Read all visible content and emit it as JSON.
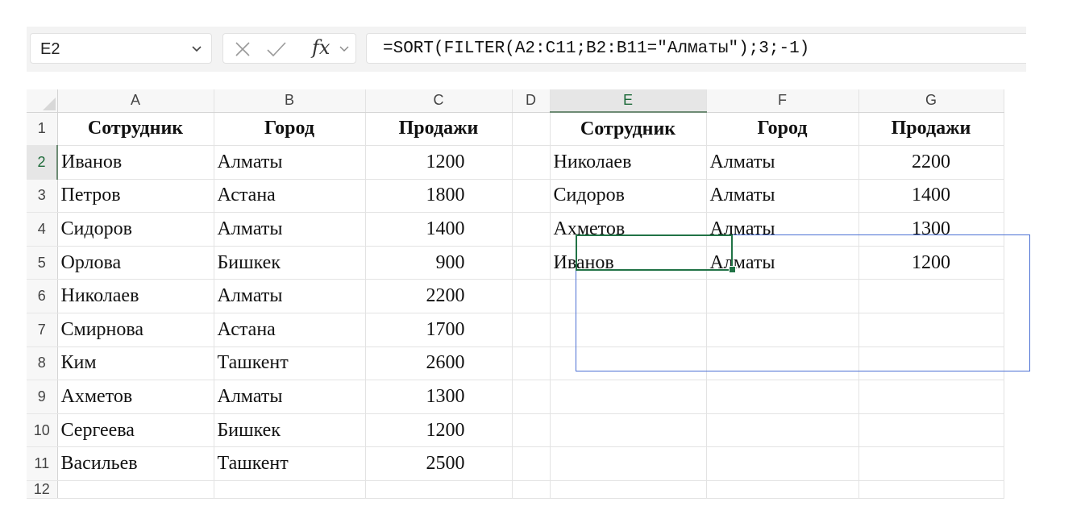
{
  "formula_bar": {
    "name_box": "E2",
    "formula": "=SORT(FILTER(A2:C11;B2:B11=\"Алматы\");3;-1)",
    "fx_label": "fx"
  },
  "columns": [
    "A",
    "B",
    "C",
    "D",
    "E",
    "F",
    "G"
  ],
  "selected_cell": "E2",
  "rows": [
    {
      "num": "1",
      "A": "Сотрудник",
      "B": "Город",
      "C": "Продажи",
      "D": "",
      "E": "Сотрудник",
      "F": "Город",
      "G": "Продажи"
    },
    {
      "num": "2",
      "A": "Иванов",
      "B": "Алматы",
      "C": "1200",
      "D": "",
      "E": "Николаев",
      "F": "Алматы",
      "G": "2200"
    },
    {
      "num": "3",
      "A": "Петров",
      "B": "Астана",
      "C": "1800",
      "D": "",
      "E": "Сидоров",
      "F": "Алматы",
      "G": "1400"
    },
    {
      "num": "4",
      "A": "Сидоров",
      "B": "Алматы",
      "C": "1400",
      "D": "",
      "E": "Ахметов",
      "F": "Алматы",
      "G": "1300"
    },
    {
      "num": "5",
      "A": "Орлова",
      "B": "Бишкек",
      "C": "900",
      "D": "",
      "E": "Иванов",
      "F": "Алматы",
      "G": "1200"
    },
    {
      "num": "6",
      "A": "Николаев",
      "B": "Алматы",
      "C": "2200",
      "D": "",
      "E": "",
      "F": "",
      "G": ""
    },
    {
      "num": "7",
      "A": "Смирнова",
      "B": "Астана",
      "C": "1700",
      "D": "",
      "E": "",
      "F": "",
      "G": ""
    },
    {
      "num": "8",
      "A": "Ким",
      "B": "Ташкент",
      "C": "2600",
      "D": "",
      "E": "",
      "F": "",
      "G": ""
    },
    {
      "num": "9",
      "A": "Ахметов",
      "B": "Алматы",
      "C": "1300",
      "D": "",
      "E": "",
      "F": "",
      "G": ""
    },
    {
      "num": "10",
      "A": "Сергеева",
      "B": "Бишкек",
      "C": "1200",
      "D": "",
      "E": "",
      "F": "",
      "G": ""
    },
    {
      "num": "11",
      "A": "Васильев",
      "B": "Ташкент",
      "C": "2500",
      "D": "",
      "E": "",
      "F": "",
      "G": ""
    }
  ],
  "partial_row": "12",
  "colors": {
    "accent_green": "#217346",
    "spill_border": "#4a6fd3"
  }
}
